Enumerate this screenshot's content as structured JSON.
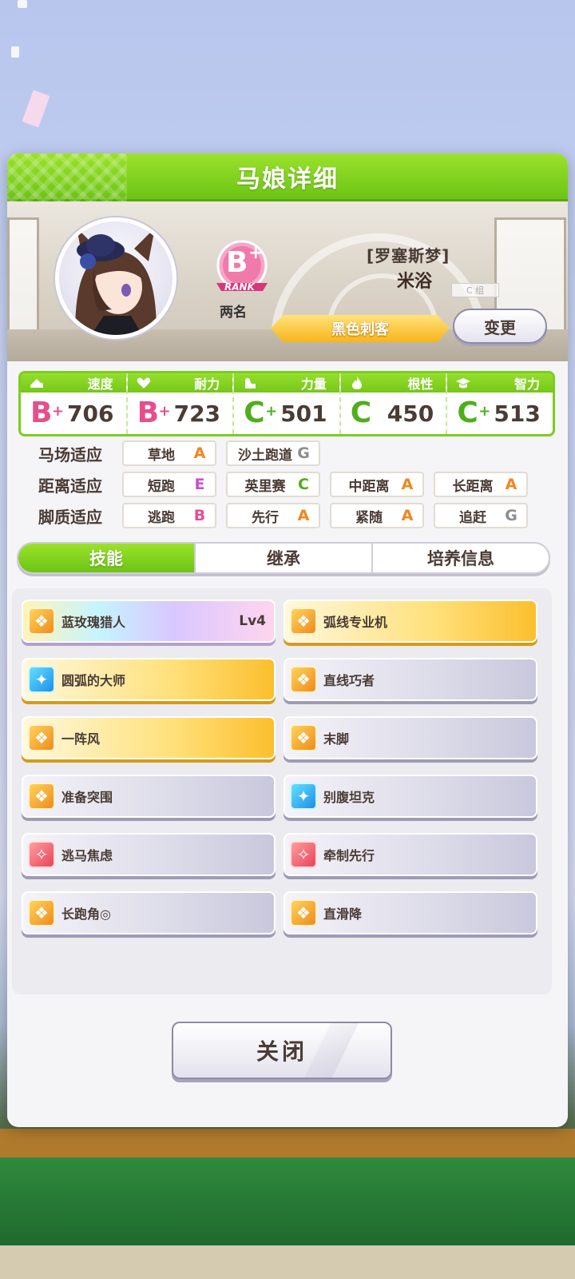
{
  "header": {
    "title": "马娘详细"
  },
  "profile": {
    "rank_letter": "B",
    "rank_plus": "+",
    "rank_word": "RANK",
    "rank_sub": "两名",
    "name_bracket": "[罗塞斯梦]",
    "name": "米浴",
    "title_ribbon": "黑色刺客",
    "change_label": "变更",
    "c_tag": "C 组"
  },
  "stats": [
    {
      "label": "速度",
      "icon": "shoe-icon",
      "grade": "B",
      "plus": "+",
      "grade_color": "#e64e8c",
      "value": "706"
    },
    {
      "label": "耐力",
      "icon": "heart-icon",
      "grade": "B",
      "plus": "+",
      "grade_color": "#e64e8c",
      "value": "723"
    },
    {
      "label": "力量",
      "icon": "muscle-icon",
      "grade": "C",
      "plus": "+",
      "grade_color": "#4fae1b",
      "value": "501"
    },
    {
      "label": "根性",
      "icon": "flame-icon",
      "grade": "C",
      "plus": "",
      "grade_color": "#4fae1b",
      "value": "450"
    },
    {
      "label": "智力",
      "icon": "graduation-cap-icon",
      "grade": "C",
      "plus": "+",
      "grade_color": "#4fae1b",
      "value": "513"
    }
  ],
  "aptitude": {
    "track": {
      "label": "马场适应",
      "items": [
        {
          "name": "草地",
          "grade": "A"
        },
        {
          "name": "沙土跑道",
          "grade": "G"
        }
      ]
    },
    "distance": {
      "label": "距离适应",
      "items": [
        {
          "name": "短跑",
          "grade": "E"
        },
        {
          "name": "英里赛",
          "grade": "C"
        },
        {
          "name": "中距离",
          "grade": "A"
        },
        {
          "name": "长距离",
          "grade": "A"
        }
      ]
    },
    "style": {
      "label": "脚质适应",
      "items": [
        {
          "name": "逃跑",
          "grade": "B"
        },
        {
          "name": "先行",
          "grade": "A"
        },
        {
          "name": "紧随",
          "grade": "A"
        },
        {
          "name": "追赶",
          "grade": "G"
        }
      ]
    }
  },
  "tabs": [
    {
      "label": "技能",
      "active": true
    },
    {
      "label": "继承",
      "active": false
    },
    {
      "label": "培养信息",
      "active": false
    }
  ],
  "skills": [
    {
      "name": "蓝玫瑰猎人",
      "lv": "Lv4",
      "style": "rainbow",
      "icon": "speed-skill-icon"
    },
    {
      "name": "弧线专业机",
      "lv": "",
      "style": "gold",
      "icon": "speed-skill-icon"
    },
    {
      "name": "圆弧的大师",
      "lv": "",
      "style": "gold",
      "icon": "recovery-skill-icon"
    },
    {
      "name": "直线巧者",
      "lv": "",
      "style": "plain",
      "icon": "speed-skill-icon"
    },
    {
      "name": "一阵风",
      "lv": "",
      "style": "gold",
      "icon": "speed-skill-icon"
    },
    {
      "name": "末脚",
      "lv": "",
      "style": "plain",
      "icon": "speed-skill-icon"
    },
    {
      "name": "准备突围",
      "lv": "",
      "style": "plain",
      "icon": "speed-skill-icon"
    },
    {
      "name": "别腹坦克",
      "lv": "",
      "style": "plain",
      "icon": "recovery-skill-icon"
    },
    {
      "name": "逃马焦虑",
      "lv": "",
      "style": "plain",
      "icon": "debuff-skill-icon"
    },
    {
      "name": "牵制先行",
      "lv": "",
      "style": "plain",
      "icon": "debuff-skill-icon"
    },
    {
      "name": "长跑角◎",
      "lv": "",
      "style": "plain",
      "icon": "speed-skill-icon"
    },
    {
      "name": "直滑降",
      "lv": "",
      "style": "plain",
      "icon": "speed-skill-icon"
    }
  ],
  "footer": {
    "close_label": "关闭"
  }
}
